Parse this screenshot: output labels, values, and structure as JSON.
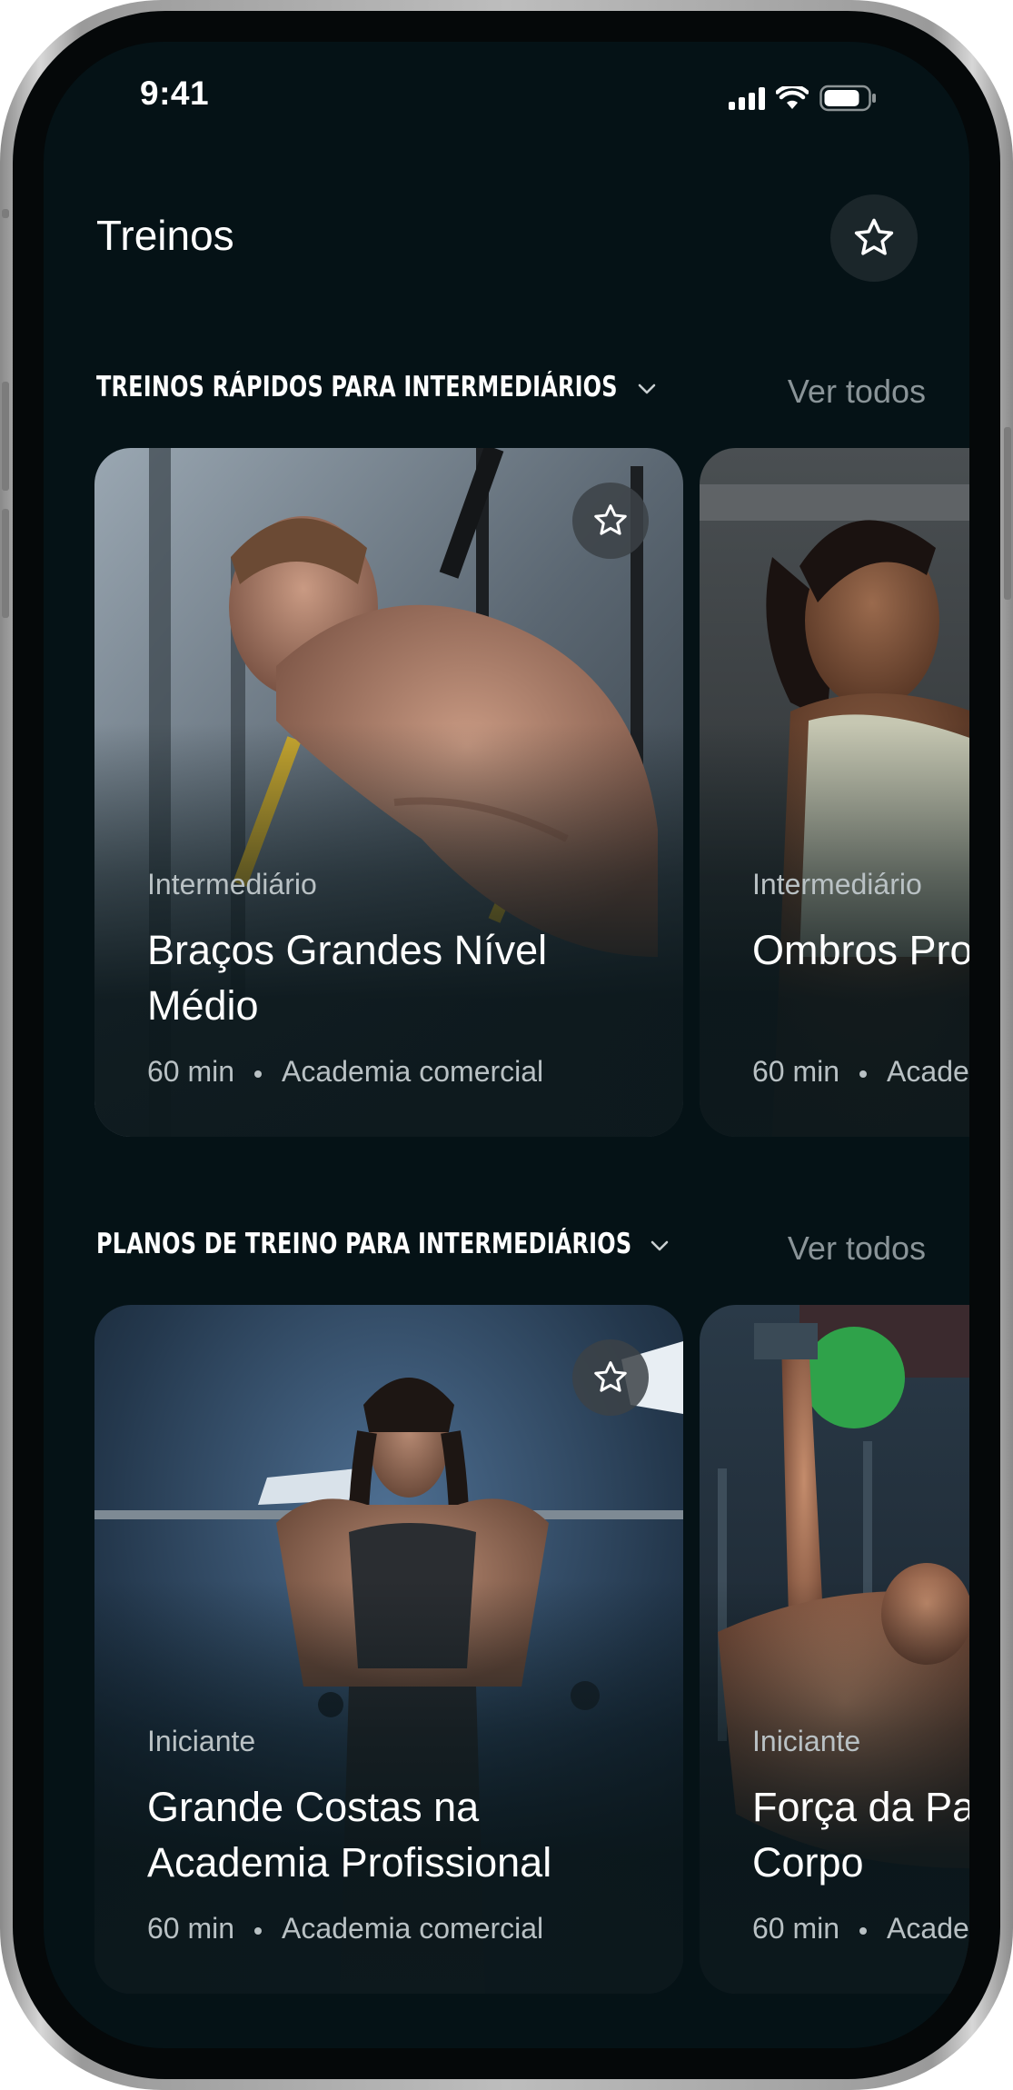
{
  "status_bar": {
    "time": "9:41"
  },
  "header": {
    "title": "Treinos",
    "favorite_icon": "star-outline-icon"
  },
  "sections": [
    {
      "title": "TREINOS RÁPIDOS PARA INTERMEDIÁRIOS",
      "see_all": "Ver todos",
      "cards": [
        {
          "level": "Intermediário",
          "title": "Braços Grandes Nível Médio",
          "duration": "60 min",
          "location": "Academia comercial"
        },
        {
          "level": "Intermediário",
          "title": "Ombros Profissionais",
          "duration": "60 min",
          "location": "Academia comercial"
        }
      ]
    },
    {
      "title": "PLANOS DE TREINO PARA INTERMEDIÁRIOS",
      "see_all": "Ver todos",
      "cards": [
        {
          "level": "Iniciante",
          "title": "Grande Costas na Academia Profissional",
          "duration": "60 min",
          "location": "Academia comercial"
        },
        {
          "level": "Iniciante",
          "title": "Força da Parte Superior do Corpo",
          "duration": "60 min",
          "location": "Academia comercial"
        }
      ]
    }
  ],
  "colors": {
    "background": "#051216",
    "text_primary": "#ffffff",
    "text_secondary": "#8a9498"
  }
}
